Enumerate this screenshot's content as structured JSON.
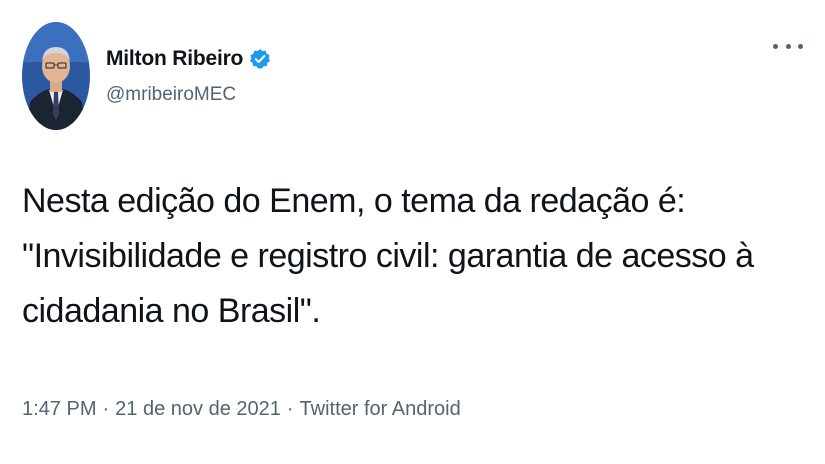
{
  "tweet": {
    "author": {
      "name": "Milton Ribeiro",
      "handle": "@mribeiroMEC",
      "verified": true,
      "verified_color": "#1d9bf0"
    },
    "more_icon": "more-horizontal-icon",
    "text_lines": [
      "Nesta edição do Enem, o tema da redação é:",
      "\"Invisibilidade e registro civil: garantia de acesso à",
      "cidadania no Brasil\"."
    ],
    "meta": {
      "time": "1:47 PM",
      "separator": "·",
      "date": "21 de nov de 2021",
      "source": "Twitter for Android"
    }
  }
}
